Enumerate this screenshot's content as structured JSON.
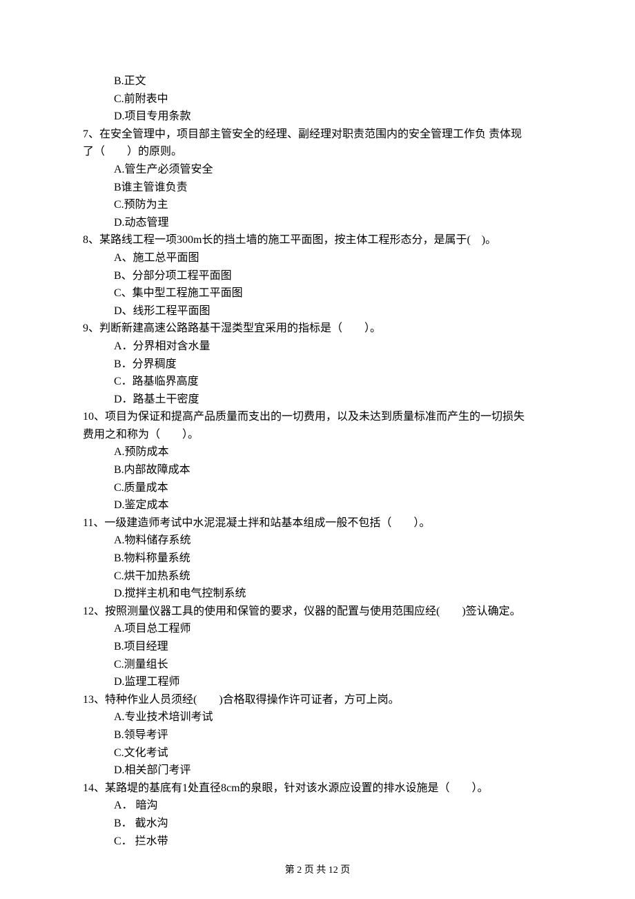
{
  "precontext": {
    "b": "B.正文",
    "c": "C.前附表中",
    "d": "D.项目专用条款"
  },
  "q7": {
    "stem_line1": "7、在安全管理中，项目部主管安全的经理、副经理对职责范围内的安全管理工作负 责体现",
    "stem_line2": "了（　　）的原则。",
    "a": "A.管生产必须管安全",
    "b": "B谁主管谁负责",
    "c": "C.预防为主",
    "d": "D.动态管理"
  },
  "q8": {
    "stem": "8、某路线工程一项300m长的挡土墙的施工平面图，按主体工程形态分，是属于(　)。",
    "a": "A、施工总平面图",
    "b": "B、分部分项工程平面图",
    "c": "C、集中型工程施工平面图",
    "d": "D、线形工程平面图"
  },
  "q9": {
    "stem": "9、判断新建高速公路路基干湿类型宜采用的指标是（　　）。",
    "a": "A．分界相对含水量",
    "b": "B．分界稠度",
    "c": "C．路基临界高度",
    "d": "D．路基土干密度"
  },
  "q10": {
    "stem_line1": "10、项目为保证和提高产品质量而支出的一切费用，以及未达到质量标准而产生的一切损失",
    "stem_line2": "费用之和称为（　　）。",
    "a": "A.预防成本",
    "b": "B.内部故障成本",
    "c": "C.质量成本",
    "d": "D.鉴定成本"
  },
  "q11": {
    "stem": "11、一级建造师考试中水泥混凝土拌和站基本组成一般不包括（　　）。",
    "a": "A.物料储存系统",
    "b": "B.物料称量系统",
    "c": "C.烘干加热系统",
    "d": "D.搅拌主机和电气控制系统"
  },
  "q12": {
    "stem": "12、按照测量仪器工具的使用和保管的要求，仪器的配置与使用范围应经(　　)签认确定。",
    "a": "A.项目总工程师",
    "b": "B.项目经理",
    "c": "C.测量组长",
    "d": "D.监理工程师"
  },
  "q13": {
    "stem": "13、特种作业人员须经(　　)合格取得操作许可证者，方可上岗。",
    "a": "A.专业技术培训考试",
    "b": "B.领导考评",
    "c": "C.文化考试",
    "d": "D.相关部门考评"
  },
  "q14": {
    "stem": "14、某路堤的基底有1处直径8cm的泉眼，针对该水源应设置的排水设施是（　　）。",
    "a": "A． 暗沟",
    "b": "B． 截水沟",
    "c": "C． 拦水带"
  },
  "footer": "第 2 页 共 12 页"
}
